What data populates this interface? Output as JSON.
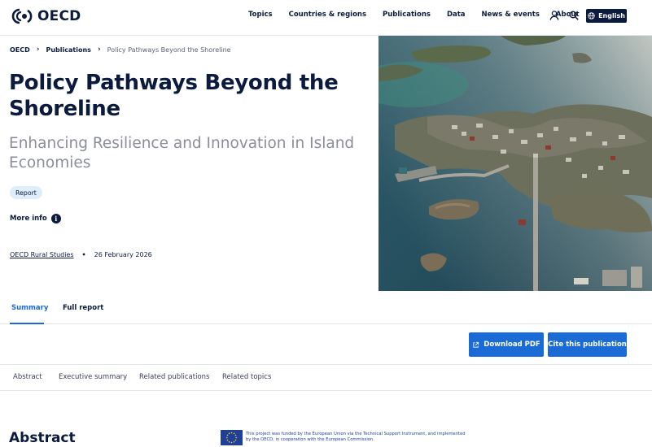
{
  "header": {
    "logo_text": "OECD",
    "nav": [
      "Topics",
      "Countries & regions",
      "Publications",
      "Data",
      "News & events",
      "About"
    ],
    "language_label": "English",
    "icons": [
      "user-icon",
      "search-icon",
      "globe-icon"
    ]
  },
  "breadcrumb": [
    "OECD",
    "Publications",
    "Policy Pathways Beyond the Shoreline"
  ],
  "page": {
    "title": "Policy Pathways Beyond the Shoreline",
    "subtitle": "Enhancing Resilience and Innovation in Island Economies",
    "tag": "Report",
    "more_info": "More info",
    "series": "OECD Rural Studies",
    "date": "26 February 2026"
  },
  "tabs": [
    "Summary",
    "Full report"
  ],
  "actions": {
    "download": "Download PDF",
    "cite": "Cite this publication"
  },
  "subnav": [
    "Abstract",
    "Executive summary",
    "Related publications",
    "Related topics"
  ],
  "abstract": {
    "heading": "Abstract",
    "eu_notice": "This project was funded by the European Union via the Technical Support Instrument, and implemented by the OECD, in cooperation with the European Commission."
  },
  "colors": {
    "navy": "#0b1a3d",
    "accent_blue": "#1a6bd6",
    "tag_bg": "#dfeefd"
  }
}
